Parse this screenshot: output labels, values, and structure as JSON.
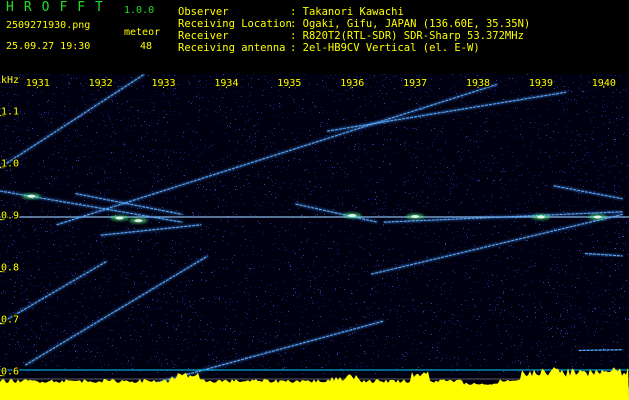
{
  "header": {
    "logo": "HROFFT",
    "version": "1.0.0",
    "filename": "2509271930.png",
    "datetime": "25.09.27 19:30",
    "meteor_label": "meteor",
    "meteor_count": "48",
    "info": [
      {
        "label": "Observer",
        "value": ": Takanori Kawachi"
      },
      {
        "label": "Receiving Location",
        "value": ": Ogaki, Gifu, JAPAN (136.60E, 35.35N)"
      },
      {
        "label": "Receiver",
        "value": ": R820T2(RTL-SDR) SDR-Sharp 53.372MHz"
      },
      {
        "label": "Receiving antenna",
        "value": ": 2el-HB9CV Vertical (el. E-W)"
      }
    ]
  },
  "colors": {
    "background": "#000010",
    "noise": "#1a2a9a",
    "signal": "#4a9aff",
    "peak": "#ffffff",
    "axis_text": "#ffff00",
    "histogram": "#ffff00",
    "baseline": "#00ccff"
  },
  "chart_data": {
    "type": "heatmap",
    "ylabel": "kHz",
    "x_ticks": [
      "1931",
      "1932",
      "1933",
      "1934",
      "1935",
      "1936",
      "1937",
      "1938",
      "1939",
      "1940"
    ],
    "y_ticks": [
      "1.1",
      "1.0",
      "0.9",
      "0.8",
      "0.7",
      "0.6"
    ],
    "ylim": [
      0.58,
      1.18
    ],
    "xlim": [
      1930.4,
      1940.4
    ],
    "carrier_khz": 0.905,
    "traces": [
      {
        "x": [
          1930.4,
          1932.7
        ],
        "y": [
          1.0,
          1.18
        ]
      },
      {
        "x": [
          1931.3,
          1938.3
        ],
        "y": [
          0.89,
          1.16
        ]
      },
      {
        "x": [
          1935.6,
          1939.4
        ],
        "y": [
          1.07,
          1.145
        ]
      },
      {
        "x": [
          1930.4,
          1932.1
        ],
        "y": [
          0.7,
          0.82
        ]
      },
      {
        "x": [
          1930.8,
          1933.7
        ],
        "y": [
          0.62,
          0.83
        ]
      },
      {
        "x": [
          1932.7,
          1936.5
        ],
        "y": [
          0.58,
          0.705
        ]
      },
      {
        "x": [
          1936.3,
          1940.3
        ],
        "y": [
          0.795,
          0.91
        ]
      },
      {
        "x": [
          1930.4,
          1933.3
        ],
        "y": [
          0.955,
          0.895
        ]
      },
      {
        "x": [
          1931.6,
          1933.3
        ],
        "y": [
          0.95,
          0.91
        ]
      },
      {
        "x": [
          1932.0,
          1933.6
        ],
        "y": [
          0.87,
          0.89
        ]
      },
      {
        "x": [
          1935.1,
          1936.4
        ],
        "y": [
          0.93,
          0.895
        ]
      },
      {
        "x": [
          1936.5,
          1940.3
        ],
        "y": [
          0.895,
          0.915
        ]
      },
      {
        "x": [
          1939.2,
          1940.3
        ],
        "y": [
          0.965,
          0.94
        ]
      },
      {
        "x": [
          1939.7,
          1940.3
        ],
        "y": [
          0.835,
          0.83
        ]
      },
      {
        "x": [
          1939.6,
          1940.3
        ],
        "y": [
          0.648,
          0.65
        ]
      }
    ],
    "bright_spots": [
      {
        "x": 1930.9,
        "y": 0.945
      },
      {
        "x": 1932.3,
        "y": 0.903
      },
      {
        "x": 1932.6,
        "y": 0.898
      },
      {
        "x": 1936.0,
        "y": 0.908
      },
      {
        "x": 1939.0,
        "y": 0.905
      },
      {
        "x": 1939.9,
        "y": 0.905
      },
      {
        "x": 1937.0,
        "y": 0.906
      }
    ]
  }
}
